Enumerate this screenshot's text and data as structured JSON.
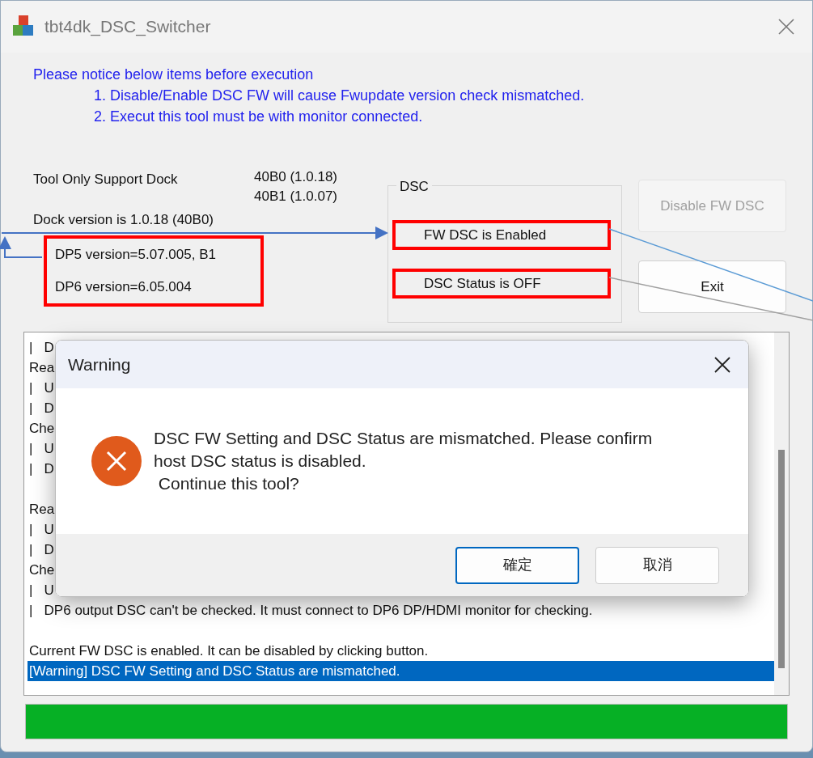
{
  "window": {
    "title": "tbt4dk_DSC_Switcher"
  },
  "notice": {
    "heading": "Please notice below items before execution",
    "items": [
      "1. Disable/Enable DSC FW will cause Fwupdate version check mismatched.",
      "2. Execut this tool must be with monitor connected."
    ]
  },
  "tool_support": {
    "label": "Tool Only Support Dock",
    "versions": [
      "40B0 (1.0.18)",
      "40B1 (1.0.07)"
    ]
  },
  "dock_version": "Dock version is 1.0.18 (40B0)",
  "dp_versions": [
    "DP5 version=5.07.005, B1",
    "DP6 version=6.05.004"
  ],
  "dsc_group": {
    "title": "DSC",
    "fw_status": "FW DSC is Enabled",
    "status": "DSC Status is OFF"
  },
  "buttons": [
    {
      "label": "Disable FW DSC",
      "disabled": true
    },
    {
      "label": "Exit",
      "disabled": false
    }
  ],
  "log": {
    "lines": [
      {
        "text": "|   D",
        "selected": false
      },
      {
        "text": "Rea",
        "selected": false
      },
      {
        "text": "|   U",
        "selected": false
      },
      {
        "text": "|   D",
        "selected": false
      },
      {
        "text": "Che",
        "selected": false
      },
      {
        "text": "|   U",
        "selected": false
      },
      {
        "text": "|   D",
        "selected": false
      },
      {
        "selected": false
      },
      {
        "text": "Rea",
        "selected": false
      },
      {
        "text": "|   U",
        "selected": false
      },
      {
        "text": "|   D",
        "selected": false
      },
      {
        "text": "Che",
        "selected": false
      },
      {
        "text": "|   U",
        "selected": false
      },
      {
        "text": "|   DP6 output DSC can't be checked. It must connect to DP6 DP/HDMI monitor for checking.",
        "selected": false
      },
      {
        "selected": false
      },
      {
        "text": "Current FW DSC is enabled. It can be disabled by clicking button.",
        "selected": false
      },
      {
        "text": "[Warning] DSC FW Setting and DSC Status are mismatched.",
        "selected": true
      }
    ]
  },
  "progress": {
    "level": 1
  },
  "dialog": {
    "title": "Warning",
    "message": [
      "DSC FW Setting and DSC Status are mismatched. Please confirm",
      "host DSC status is disabled.",
      " Continue this tool?"
    ],
    "buttons": [
      {
        "label": "確定",
        "default": true
      },
      {
        "label": "取消",
        "default": false
      }
    ]
  }
}
